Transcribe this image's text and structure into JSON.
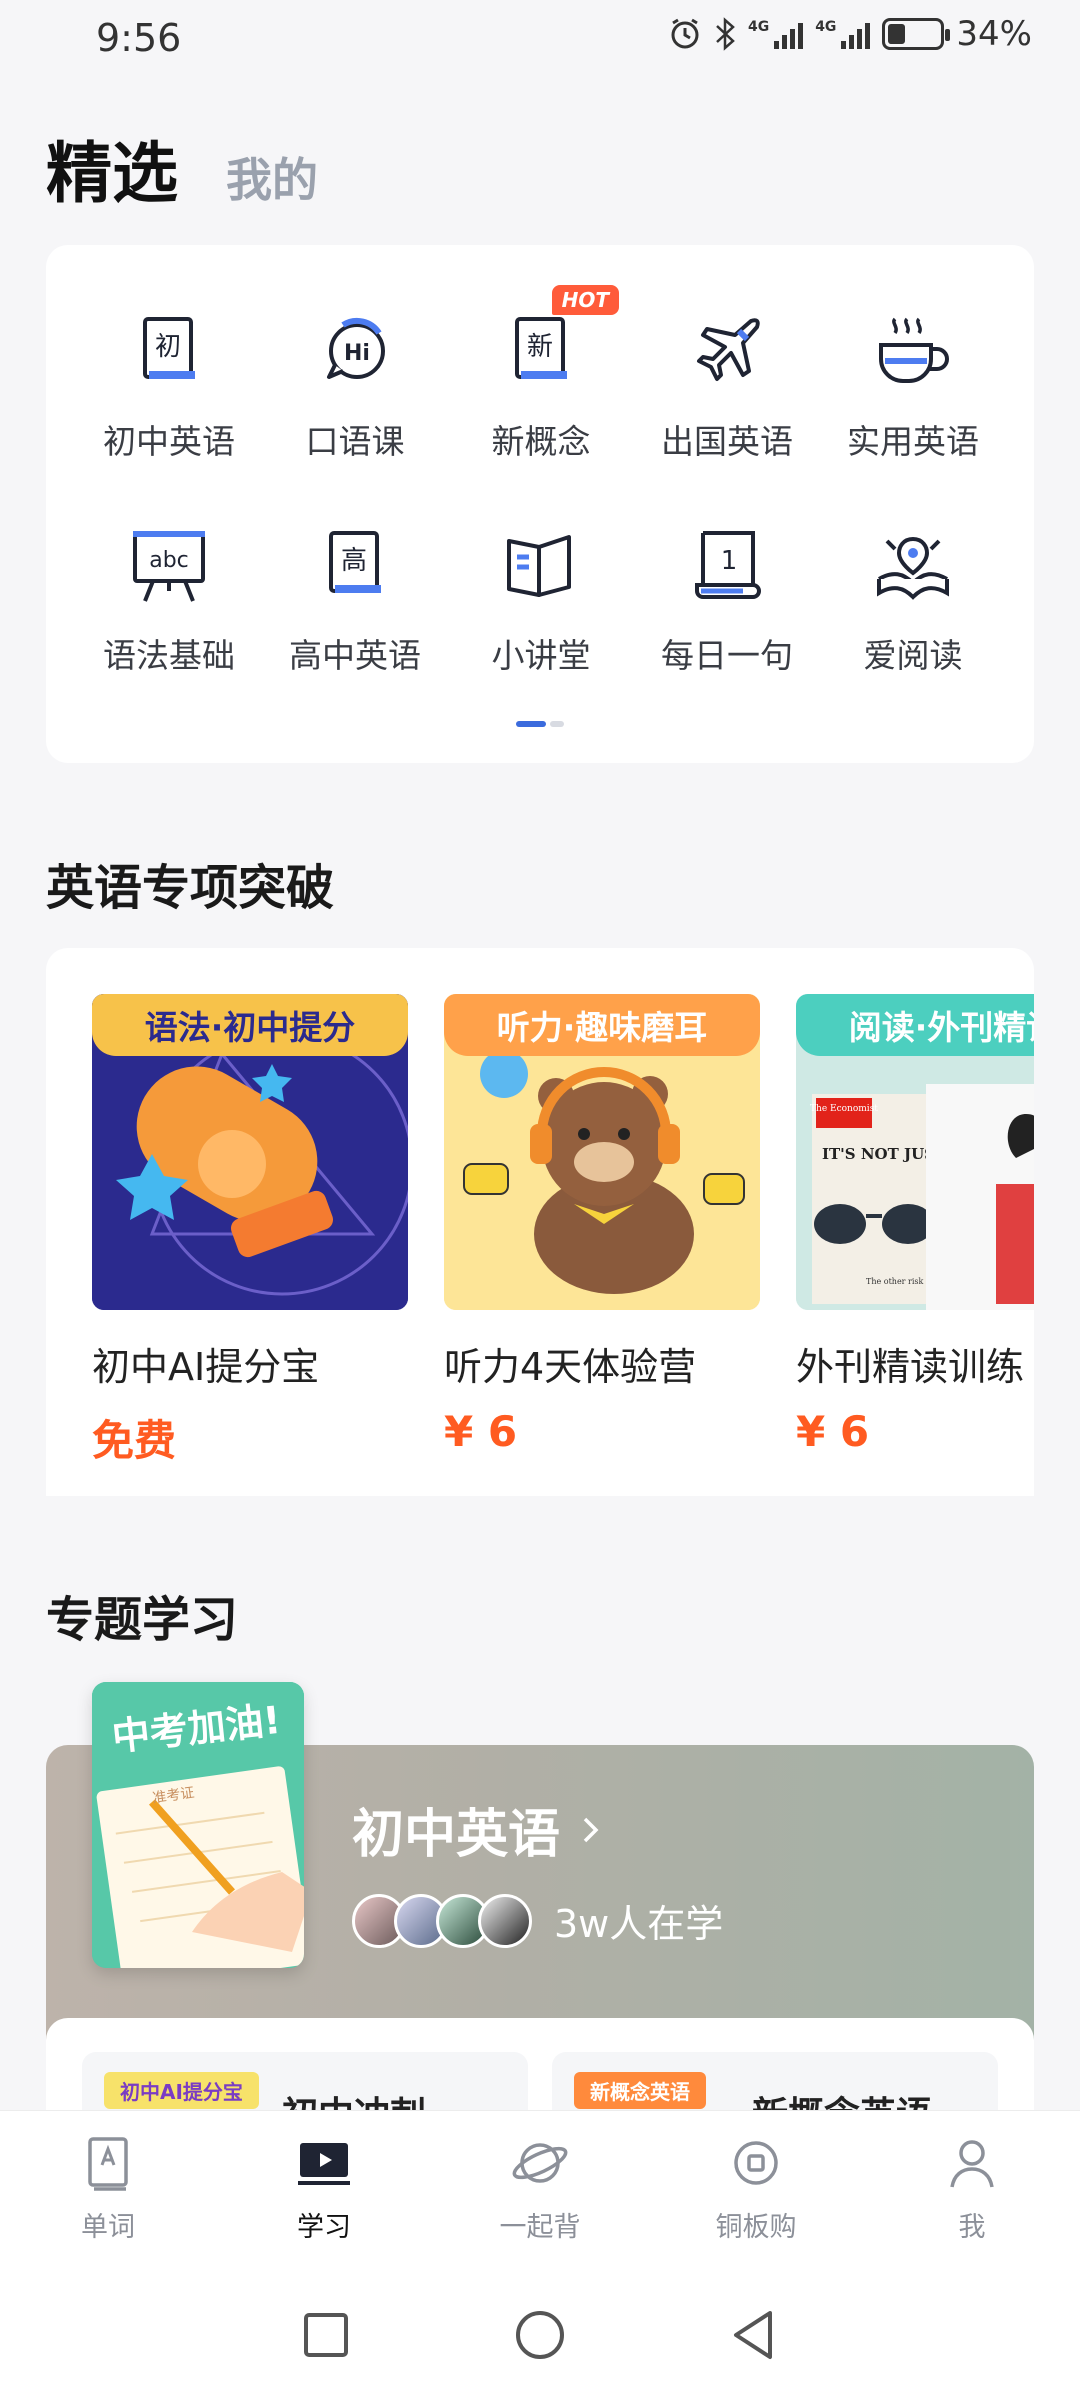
{
  "status_bar": {
    "time": "9:56",
    "network_1": "4G",
    "network_2": "4G",
    "battery_percent": "34%",
    "battery_level": 0.34
  },
  "top_tabs": {
    "active": "精选",
    "inactive": "我的"
  },
  "categories": {
    "items": [
      {
        "label": "初中英语",
        "icon": "book-chu-icon",
        "glyph": "初"
      },
      {
        "label": "口语课",
        "icon": "speech-hi-icon",
        "glyph": "Hi"
      },
      {
        "label": "新概念",
        "icon": "book-xin-icon",
        "glyph": "新",
        "badge": "HOT"
      },
      {
        "label": "出国英语",
        "icon": "airplane-icon"
      },
      {
        "label": "实用英语",
        "icon": "coffee-cup-icon"
      },
      {
        "label": "语法基础",
        "icon": "abc-board-icon",
        "glyph": "abc"
      },
      {
        "label": "高中英语",
        "icon": "book-gao-icon",
        "glyph": "高"
      },
      {
        "label": "小讲堂",
        "icon": "open-book-icon"
      },
      {
        "label": "每日一句",
        "icon": "calendar-one-icon",
        "glyph": "1"
      },
      {
        "label": "爱阅读",
        "icon": "reading-book-icon"
      }
    ]
  },
  "special_section": {
    "title": "英语专项突破",
    "courses": [
      {
        "ribbon": "语法·初中提分",
        "title": "初中AI提分宝",
        "price": "免费",
        "ribbon_color": "#f7c24a"
      },
      {
        "ribbon": "听力·趣味磨耳",
        "title": "听力4天体验营",
        "price": "¥ 6",
        "ribbon_color": "#ffa14a"
      },
      {
        "ribbon": "阅读·外刊精读",
        "title": "外刊精读训练",
        "price": "¥ 6",
        "ribbon_color": "#4ccfbf",
        "magazine_name": "The Economist",
        "magazine_headline": "IT'S NOT JUST IN",
        "magazine_sub": "The other risk of Bidenomics"
      }
    ]
  },
  "topic_section": {
    "title": "专题学习",
    "cover_text": "中考加油!",
    "cover_sub": "准考证",
    "banner_title": "初中英语",
    "learners": "3w人在学",
    "sub_cards": [
      {
        "tag": "初中AI提分宝",
        "title": "初中冲刺"
      },
      {
        "tag": "新概念英语",
        "title": "新概念英语"
      }
    ]
  },
  "bottom_nav": {
    "items": [
      {
        "label": "单词",
        "icon": "word-card-icon"
      },
      {
        "label": "学习",
        "icon": "video-play-icon",
        "active": true
      },
      {
        "label": "一起背",
        "icon": "planet-icon"
      },
      {
        "label": "铜板购",
        "icon": "coin-icon"
      },
      {
        "label": "我",
        "icon": "person-icon"
      }
    ]
  },
  "system_nav": [
    "recents-square-icon",
    "home-circle-icon",
    "back-triangle-icon"
  ],
  "colors": {
    "accent_blue": "#3b6bdd",
    "price_orange": "#ff5b21",
    "hot_badge": "#ff5b3a"
  }
}
